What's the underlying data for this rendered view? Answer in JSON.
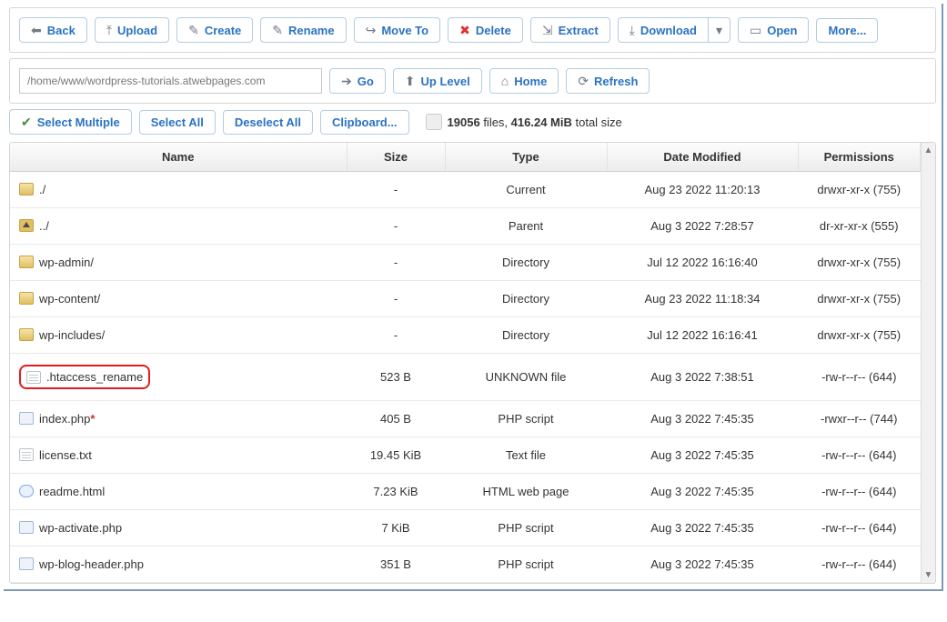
{
  "toolbar1": {
    "back": "Back",
    "upload": "Upload",
    "create": "Create",
    "rename": "Rename",
    "moveto": "Move To",
    "delete": "Delete",
    "extract": "Extract",
    "download": "Download",
    "open": "Open",
    "more": "More..."
  },
  "pathbar": {
    "path": "/home/www/wordpress-tutorials.atwebpages.com",
    "go": "Go",
    "uplevel": "Up Level",
    "home": "Home",
    "refresh": "Refresh"
  },
  "toolbar3": {
    "select_multiple": "Select Multiple",
    "select_all": "Select All",
    "deselect_all": "Deselect All",
    "clipboard": "Clipboard..."
  },
  "stats": {
    "count": "19056",
    "count_suffix": " files, ",
    "size": "416.24 MiB",
    "size_suffix": " total size"
  },
  "columns": {
    "name": "Name",
    "size": "Size",
    "type": "Type",
    "date": "Date Modified",
    "perm": "Permissions"
  },
  "rows": [
    {
      "icon": "folder",
      "name": "./",
      "size": "-",
      "type": "Current",
      "date": "Aug 23 2022 11:20:13",
      "perm": "drwxr-xr-x (755)"
    },
    {
      "icon": "up",
      "name": "../",
      "size": "-",
      "type": "Parent",
      "date": "Aug 3 2022 7:28:57",
      "perm": "dr-xr-xr-x (555)"
    },
    {
      "icon": "folder",
      "name": "wp-admin/",
      "size": "-",
      "type": "Directory",
      "date": "Jul 12 2022 16:16:40",
      "perm": "drwxr-xr-x (755)"
    },
    {
      "icon": "folder",
      "name": "wp-content/",
      "size": "-",
      "type": "Directory",
      "date": "Aug 23 2022 11:18:34",
      "perm": "drwxr-xr-x (755)"
    },
    {
      "icon": "folder",
      "name": "wp-includes/",
      "size": "-",
      "type": "Directory",
      "date": "Jul 12 2022 16:16:41",
      "perm": "drwxr-xr-x (755)"
    },
    {
      "icon": "file",
      "name": ".htaccess_rename",
      "size": "523 B",
      "type": "UNKNOWN file",
      "date": "Aug 3 2022 7:38:51",
      "perm": "-rw-r--r-- (644)",
      "highlight": true
    },
    {
      "icon": "php",
      "name": "index.php",
      "modified": true,
      "size": "405 B",
      "type": "PHP script",
      "date": "Aug 3 2022 7:45:35",
      "perm": "-rwxr--r-- (744)"
    },
    {
      "icon": "file",
      "name": "license.txt",
      "size": "19.45 KiB",
      "type": "Text file",
      "date": "Aug 3 2022 7:45:35",
      "perm": "-rw-r--r-- (644)"
    },
    {
      "icon": "html",
      "name": "readme.html",
      "size": "7.23 KiB",
      "type": "HTML web page",
      "date": "Aug 3 2022 7:45:35",
      "perm": "-rw-r--r-- (644)"
    },
    {
      "icon": "php",
      "name": "wp-activate.php",
      "size": "7 KiB",
      "type": "PHP script",
      "date": "Aug 3 2022 7:45:35",
      "perm": "-rw-r--r-- (644)"
    },
    {
      "icon": "php",
      "name": "wp-blog-header.php",
      "size": "351 B",
      "type": "PHP script",
      "date": "Aug 3 2022 7:45:35",
      "perm": "-rw-r--r-- (644)"
    }
  ]
}
